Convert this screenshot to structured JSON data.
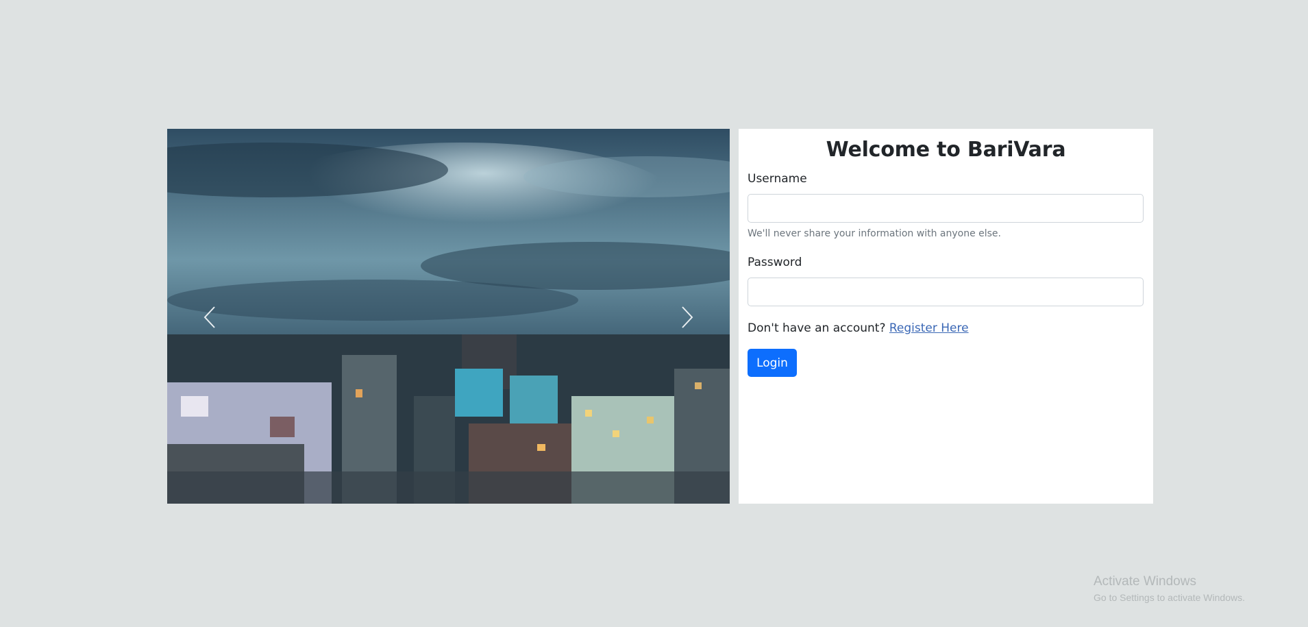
{
  "carousel": {
    "image_icon": "city-skyline-photo",
    "prev_icon": "chevron-left-icon",
    "next_icon": "chevron-right-icon"
  },
  "login": {
    "title": "Welcome to BariVara",
    "username_label": "Username",
    "username_value": "",
    "username_help": "We'll never share your information with anyone else.",
    "password_label": "Password",
    "password_value": "",
    "no_account_text": "Don't have an account?",
    "register_link": "Register Here",
    "login_button": "Login"
  },
  "watermark": {
    "line1": "Activate Windows",
    "line2": "Go to Settings to activate Windows."
  },
  "colors": {
    "page_bg": "#dee2e2",
    "primary": "#0d6efd",
    "link": "#3a67b5"
  }
}
